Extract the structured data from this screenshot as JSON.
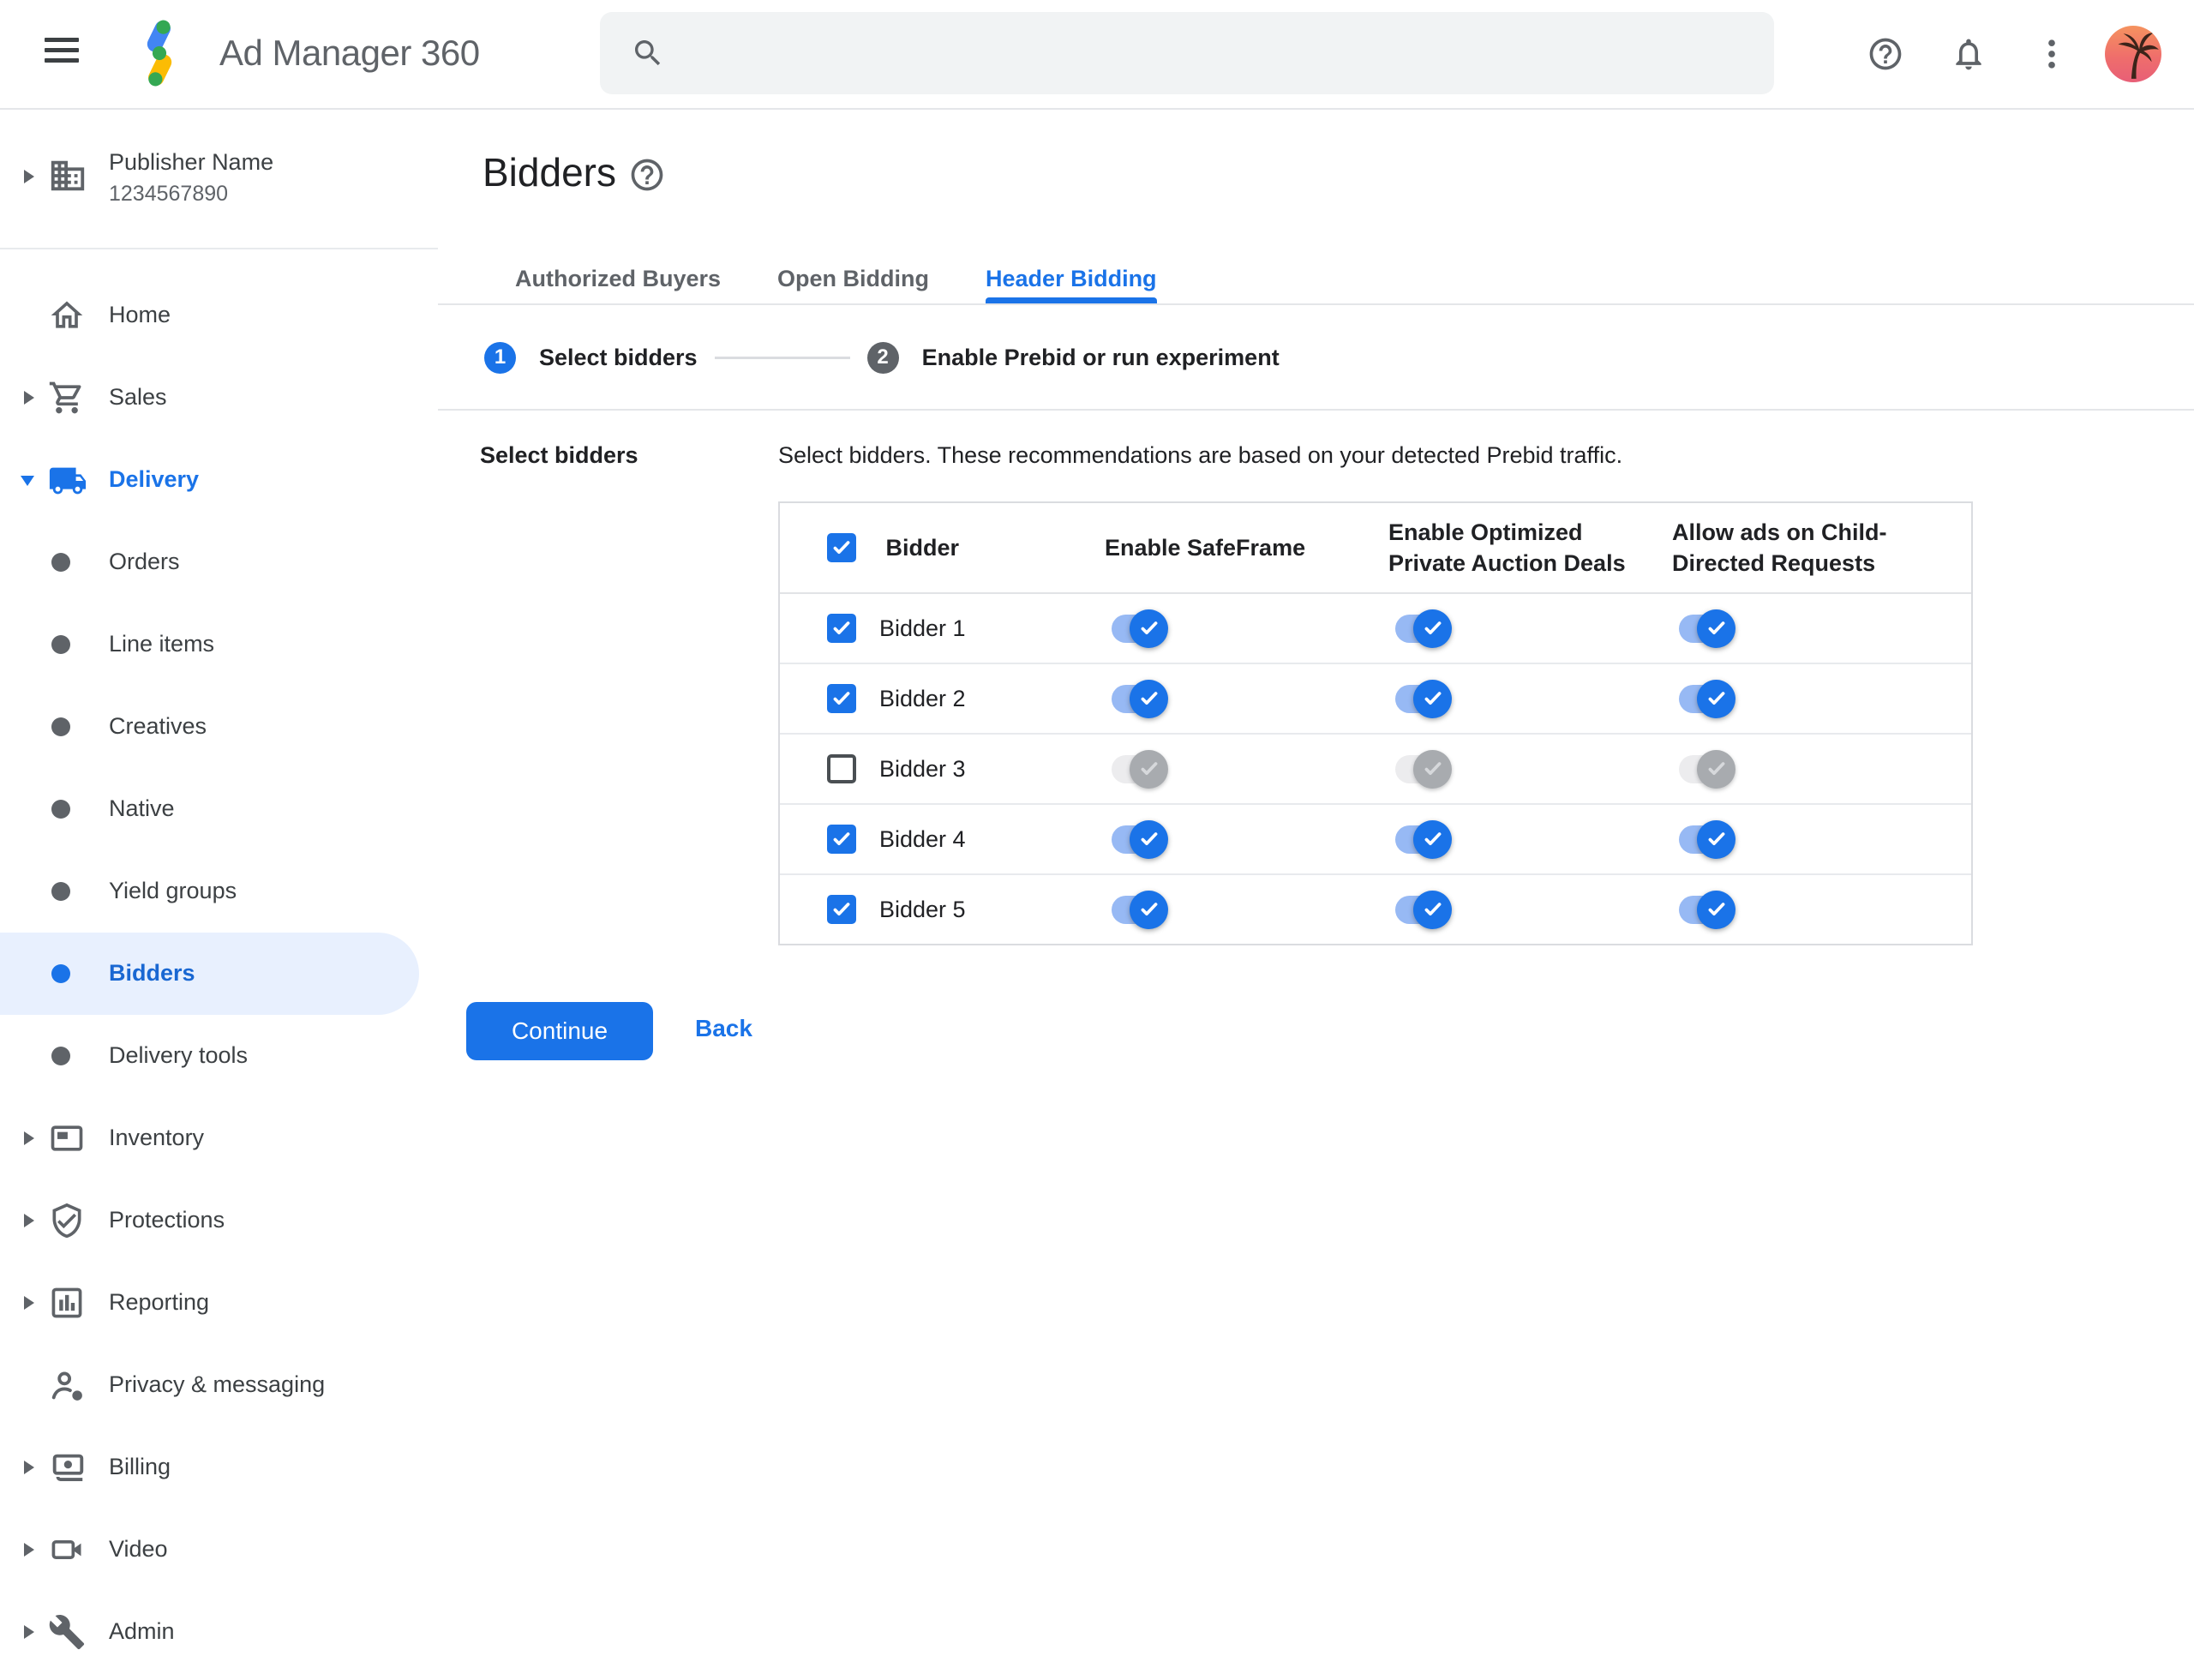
{
  "topbar": {
    "app_title": "Ad Manager 360",
    "search_placeholder": "",
    "icons": [
      "menu-icon",
      "ad-manager-logo",
      "search-icon",
      "help-icon",
      "notifications-icon",
      "more-vert-icon",
      "avatar-palm-tree"
    ]
  },
  "sidebar": {
    "publisher": {
      "name": "Publisher Name",
      "id": "1234567890",
      "icon": "building-icon",
      "arrow": "right"
    },
    "items": [
      {
        "label": "Home",
        "icon": "home-icon",
        "arrow": "none",
        "sub": false,
        "active": false,
        "blue": false
      },
      {
        "label": "Sales",
        "icon": "cart-icon",
        "arrow": "right",
        "sub": false,
        "active": false,
        "blue": false
      },
      {
        "label": "Delivery",
        "icon": "truck-icon",
        "arrow": "down",
        "sub": false,
        "active": false,
        "blue": true
      },
      {
        "label": "Orders",
        "icon": "dot",
        "arrow": "none",
        "sub": true,
        "active": false,
        "blue": false
      },
      {
        "label": "Line items",
        "icon": "dot",
        "arrow": "none",
        "sub": true,
        "active": false,
        "blue": false
      },
      {
        "label": "Creatives",
        "icon": "dot",
        "arrow": "none",
        "sub": true,
        "active": false,
        "blue": false
      },
      {
        "label": "Native",
        "icon": "dot",
        "arrow": "none",
        "sub": true,
        "active": false,
        "blue": false
      },
      {
        "label": "Yield groups",
        "icon": "dot",
        "arrow": "none",
        "sub": true,
        "active": false,
        "blue": false
      },
      {
        "label": "Bidders",
        "icon": "dot",
        "arrow": "none",
        "sub": true,
        "active": true,
        "blue": false
      },
      {
        "label": "Delivery tools",
        "icon": "dot",
        "arrow": "none",
        "sub": true,
        "active": false,
        "blue": false
      },
      {
        "label": "Inventory",
        "icon": "inventory-icon",
        "arrow": "right",
        "sub": false,
        "active": false,
        "blue": false
      },
      {
        "label": "Protections",
        "icon": "shield-check-icon",
        "arrow": "right",
        "sub": false,
        "active": false,
        "blue": false
      },
      {
        "label": "Reporting",
        "icon": "bar-chart-icon",
        "arrow": "right",
        "sub": false,
        "active": false,
        "blue": false
      },
      {
        "label": "Privacy & messaging",
        "icon": "person-badge-icon",
        "arrow": "none",
        "sub": false,
        "active": false,
        "blue": false
      },
      {
        "label": "Billing",
        "icon": "money-icon",
        "arrow": "right",
        "sub": false,
        "active": false,
        "blue": false
      },
      {
        "label": "Video",
        "icon": "video-camera-icon",
        "arrow": "right",
        "sub": false,
        "active": false,
        "blue": false
      },
      {
        "label": "Admin",
        "icon": "wrench-icon",
        "arrow": "right",
        "sub": false,
        "active": false,
        "blue": false
      }
    ]
  },
  "main": {
    "page_title": "Bidders",
    "title_help_icon": "help-icon",
    "tabs": [
      {
        "label": "Authorized Buyers",
        "active": false
      },
      {
        "label": "Open Bidding",
        "active": false
      },
      {
        "label": "Header Bidding",
        "active": true
      }
    ],
    "stepper": [
      {
        "number": "1",
        "label": "Select bidders",
        "state": "active"
      },
      {
        "number": "2",
        "label": "Enable Prebid or run experiment",
        "state": "upcoming"
      }
    ],
    "section_label": "Select bidders",
    "description": "Select bidders. These recommendations are based on your detected Prebid traffic.",
    "table": {
      "select_all_checked": true,
      "headers": [
        "Bidder",
        "Enable SafeFrame",
        "Enable Optimized Private Auction Deals",
        "Allow ads on Child-Directed Requests"
      ],
      "rows": [
        {
          "label": "Bidder 1",
          "selected": true,
          "enable_safeframe": true,
          "enable_optimized_private_auction_deals": true,
          "allow_ads_child_directed": true
        },
        {
          "label": "Bidder 2",
          "selected": true,
          "enable_safeframe": true,
          "enable_optimized_private_auction_deals": true,
          "allow_ads_child_directed": true
        },
        {
          "label": "Bidder 3",
          "selected": false,
          "enable_safeframe": false,
          "enable_optimized_private_auction_deals": false,
          "allow_ads_child_directed": false
        },
        {
          "label": "Bidder 4",
          "selected": true,
          "enable_safeframe": true,
          "enable_optimized_private_auction_deals": true,
          "allow_ads_child_directed": true
        },
        {
          "label": "Bidder 5",
          "selected": true,
          "enable_safeframe": true,
          "enable_optimized_private_auction_deals": true,
          "allow_ads_child_directed": true
        }
      ]
    },
    "continue_label": "Continue",
    "back_label": "Back"
  },
  "colors": {
    "accent_blue": "#1a73e8",
    "active_item_bg": "#e8f0fe",
    "active_item_text": "#1967d2",
    "toggle_track_on": "#97b9f4",
    "toggle_track_off": "#ececee",
    "toggle_knob_off": "#a8abaf",
    "step_upcoming_circle": "#5f6368",
    "border_gray": "#dadce0",
    "text_primary": "#202124",
    "text_secondary": "#5f6368",
    "search_bg": "#f1f3f4",
    "logo_blue": "#4285f4",
    "logo_yellow": "#fbbc04",
    "logo_green": "#34a853"
  }
}
